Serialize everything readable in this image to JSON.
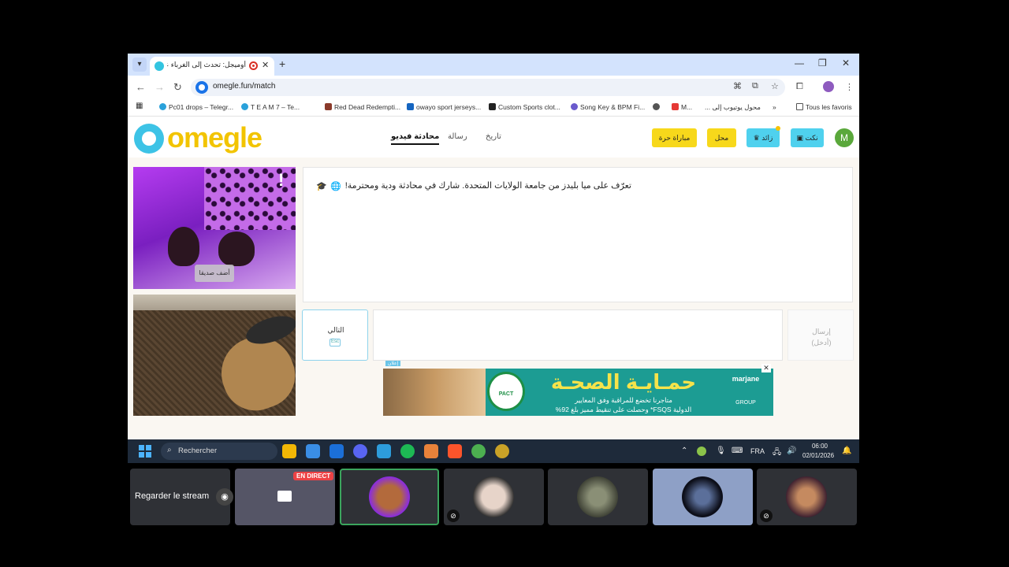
{
  "browser": {
    "tab_title": "أوميجل: تحدث إلى الغرباء عبر",
    "url": "omegle.fun/match",
    "bookmarks": [
      "Pc01 drops – Telegr...",
      "T E A M 7 – Te...",
      "Red Dead Redempti...",
      "owayo sport jerseys...",
      "Custom Sports clot...",
      "Song Key & BPM Fi...",
      "M...",
      "محول يوتيوب إلى ...",
      "Tous les favoris"
    ]
  },
  "site": {
    "logo": "omegle",
    "nav": {
      "video_chat": "محادثة فيديو",
      "text_chat": "رسالة",
      "history": "تاريخ"
    },
    "buttons": {
      "free_match": "مباراة حرة",
      "shop": "محل",
      "gems": "زائد",
      "coins": "نكت"
    },
    "avatar_initial": "M",
    "add_friend": "أضف صديقا",
    "report": "!"
  },
  "chat": {
    "message": "تعرّف على ميا بليدز من جامعة الولايات المتحدة. شارك في محادثة ودية ومحترمة!",
    "next_label": "التالي",
    "next_key": "Esc",
    "send_label": "إرسال",
    "send_hint": "(أدخل)"
  },
  "ad": {
    "tag": "إعلان",
    "close": "✕",
    "badge": "PACT",
    "headline": "حمـايـة الصحـة",
    "body_line1": "متاجرنا تخضع للمراقبة وفق المعايير",
    "body_line2": "الدولية FSQS* وحصلت على تنقيط مميز بلغ 92%",
    "brand": "marjane",
    "brand_sub": "GROUP"
  },
  "taskbar": {
    "search_placeholder": "Rechercher",
    "lang": "FRA",
    "time": "06:00",
    "date": "02/01/2026"
  },
  "stream": {
    "watch_label": "Regarder le stream",
    "live_badge": "EN DIRECT"
  }
}
